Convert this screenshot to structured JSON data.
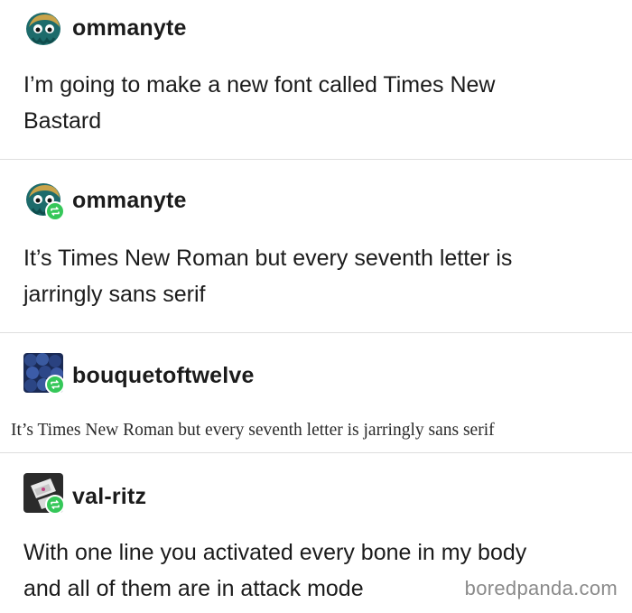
{
  "posts": [
    {
      "username": "ommanyte",
      "text_lines": [
        "I’m going to make a new font called Times New",
        "Bastard"
      ],
      "avatar_icon": "ammonite-avatar",
      "reblog": false
    },
    {
      "username": "ommanyte",
      "text_lines": [
        "It’s Times New Roman but every seventh letter is",
        "jarringly sans serif"
      ],
      "avatar_icon": "ammonite-avatar",
      "reblog": true
    },
    {
      "username": "bouquetoftwelve",
      "text_serif": "It’s Times New Roman but every seventh letter is jarringly sans serif",
      "avatar_icon": "blueberries-avatar",
      "reblog": true
    },
    {
      "username": "val-ritz",
      "text_lines": [
        "With one line you activated every bone in my body",
        "and all of them are in attack mode"
      ],
      "avatar_icon": "dark-photo-avatar",
      "reblog": true
    }
  ],
  "watermark": "boredpanda.com",
  "colors": {
    "reblog_badge": "#35c759",
    "divider": "#dedede",
    "watermark": "#8a8a8a"
  }
}
